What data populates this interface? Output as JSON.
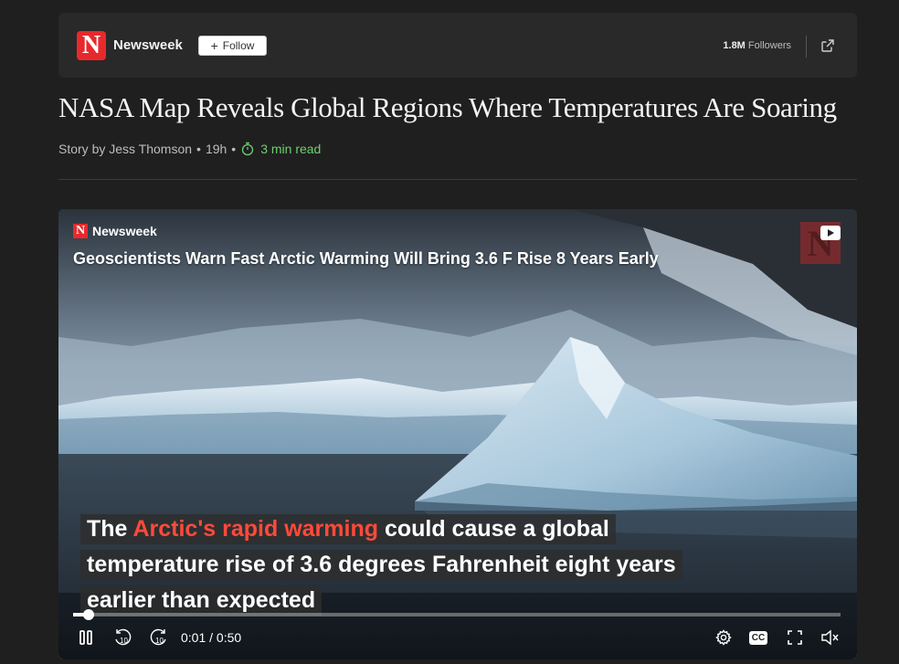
{
  "publisher": {
    "logo_letter": "N",
    "name": "Newsweek",
    "follow_label": "Follow",
    "followers_count": "1.8M",
    "followers_label": "Followers",
    "brand_color": "#e8292c"
  },
  "article": {
    "title": "NASA Map Reveals Global Regions Where Temperatures Are Soaring",
    "byline": "Story by Jess Thomson",
    "age": "19h",
    "read_time": "3 min read",
    "bullet": "•"
  },
  "video": {
    "brand": "Newsweek",
    "title": "Geoscientists Warn Fast Arctic Warming Will Bring 3.6 F Rise 8 Years Early",
    "watermark_letter": "N",
    "captions": {
      "line1_pre": "The ",
      "line1_highlight": "Arctic's rapid warming",
      "line1_post": " could cause a global",
      "line2": "temperature rise of 3.6 degrees Fahrenheit eight years",
      "line3": "earlier than expected"
    },
    "current_time": "0:01",
    "time_separator": "/",
    "duration": "0:50",
    "progress_fraction": 0.02,
    "skip_back_label": "10",
    "skip_forward_label": "10",
    "cc_label": "CC",
    "highlight_color": "#ff4a3a"
  }
}
